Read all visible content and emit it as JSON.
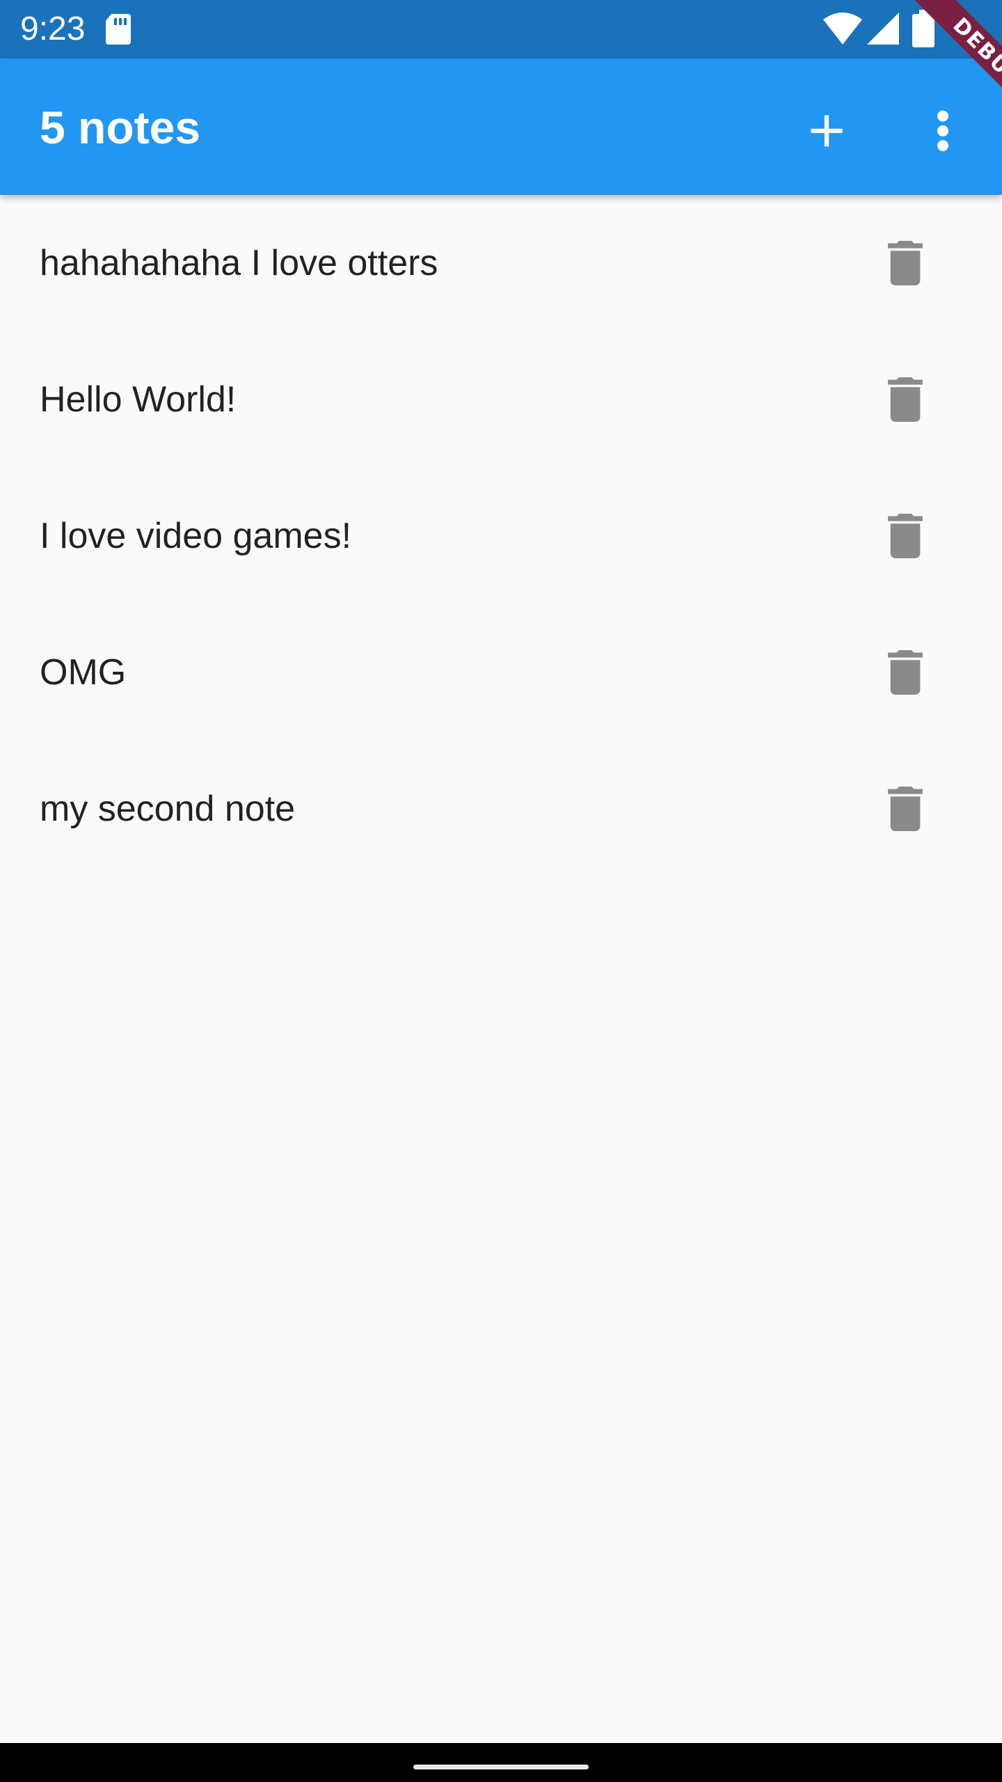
{
  "status_bar": {
    "time": "9:23",
    "icons": [
      "sd-card-icon",
      "wifi-icon",
      "cell-signal-icon",
      "battery-icon"
    ]
  },
  "app_bar": {
    "title": "5 notes",
    "actions": [
      "add-icon",
      "more-vert-icon"
    ],
    "color": "#2196f3"
  },
  "debug_banner": {
    "label": "DEBUG",
    "color": "#7a2042"
  },
  "notes": [
    {
      "text": "hahahahaha I love otters",
      "action_icon": "delete-icon"
    },
    {
      "text": "Hello World!",
      "action_icon": "delete-icon"
    },
    {
      "text": "I love video games!",
      "action_icon": "delete-icon"
    },
    {
      "text": "OMG",
      "action_icon": "delete-icon"
    },
    {
      "text": "my second note",
      "action_icon": "delete-icon"
    }
  ],
  "colors": {
    "status_bar": "#1a72bb",
    "background": "#fafafa",
    "icon_gray": "#8a8a8a"
  }
}
